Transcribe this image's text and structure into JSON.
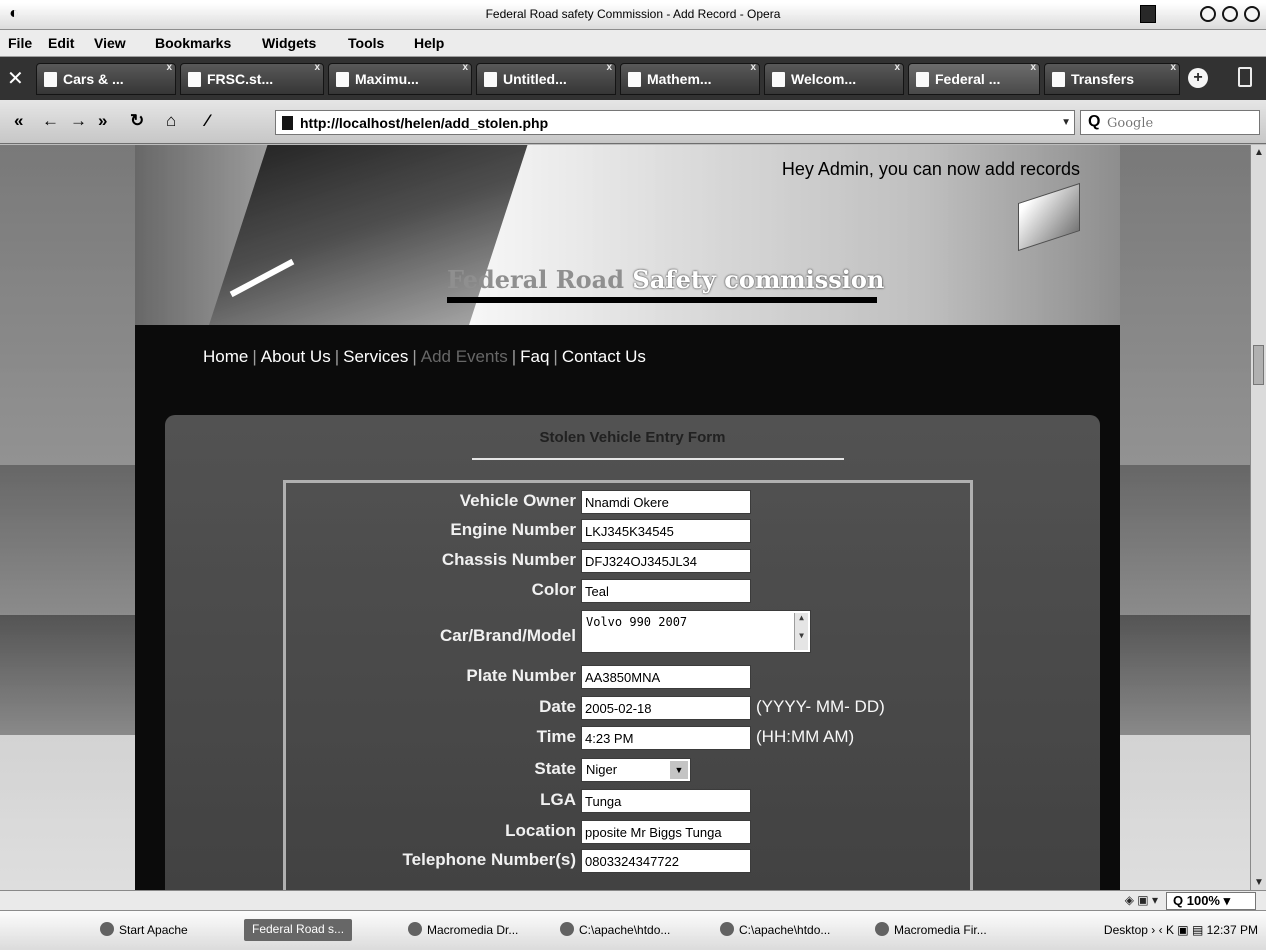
{
  "window": {
    "title": "Federal Road safety Commission - Add Record - Opera"
  },
  "menu": [
    "File",
    "Edit",
    "View",
    "Bookmarks",
    "Widgets",
    "Tools",
    "Help"
  ],
  "tabs": [
    {
      "label": "Cars & ..."
    },
    {
      "label": "FRSC.st..."
    },
    {
      "label": "Maximu..."
    },
    {
      "label": "Untitled..."
    },
    {
      "label": "Mathem..."
    },
    {
      "label": "Welcom..."
    },
    {
      "label": "Federal ...",
      "active": true
    },
    {
      "label": "Transfers"
    }
  ],
  "address": {
    "url": "http://localhost/helen/add_stolen.php",
    "search_placeholder": "Google"
  },
  "site": {
    "admin_message": "Hey Admin, you can now add records",
    "brand_part1": "Federal Road",
    "brand_part2": "Safety commission",
    "nav": [
      "Home",
      "About Us",
      "Services",
      "Add Events",
      "Faq",
      "Contact Us"
    ]
  },
  "form": {
    "title": "Stolen Vehicle Entry Form",
    "fields": {
      "owner": {
        "label": "Vehicle Owner",
        "value": "Nnamdi Okere"
      },
      "engine": {
        "label": "Engine Number",
        "value": "LKJ345K34545"
      },
      "chassis": {
        "label": "Chassis Number",
        "value": "DFJ324OJ345JL34"
      },
      "color": {
        "label": "Color",
        "value": "Teal"
      },
      "model": {
        "label": "Car/Brand/Model",
        "value": "Volvo 990 2007"
      },
      "plate": {
        "label": "Plate Number",
        "value": "AA3850MNA"
      },
      "date": {
        "label": "Date",
        "value": "2005-02-18",
        "hint": "(YYYY- MM- DD)"
      },
      "time": {
        "label": "Time",
        "value": "4:23 PM",
        "hint": "(HH:MM AM)"
      },
      "state": {
        "label": "State",
        "value": "Niger"
      },
      "lga": {
        "label": "LGA",
        "value": "Tunga"
      },
      "location": {
        "label": "Location",
        "value": "pposite Mr Biggs Tunga"
      },
      "phone": {
        "label": "Telephone Number(s)",
        "value": "0803324347722"
      }
    }
  },
  "status": {
    "zoom": "100%"
  },
  "taskbar": {
    "items": [
      "Start Apache",
      "Federal Road s...",
      "Macromedia Dr...",
      "C:\\apache\\htdo...",
      "C:\\apache\\htdo...",
      "Macromedia Fir..."
    ],
    "tray_desktop": "Desktop",
    "clock": "12:37 PM"
  }
}
